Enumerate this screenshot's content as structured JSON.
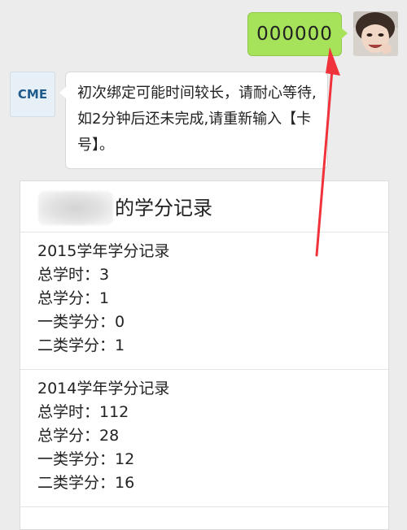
{
  "outgoing_message": {
    "text": "000000"
  },
  "incoming_message": {
    "avatar_text": "CME",
    "text": "初次绑定可能时间较长，请耐心等待,如2分钟后还未完成,请重新输入【卡号】。"
  },
  "credit_card": {
    "title": "的学分记录",
    "records": [
      {
        "heading": "2015学年学分记录",
        "lines": [
          "总学时：3",
          "总学分：1",
          "一类学分：0",
          "二类学分：1"
        ]
      },
      {
        "heading": "2014学年学分记录",
        "lines": [
          "总学时：112",
          "总学分：28",
          "一类学分：12",
          "二类学分：16"
        ]
      }
    ]
  },
  "colors": {
    "outgoing_bubble": "#a6e35a",
    "arrow": "#f0323a",
    "cme_logo": "#1f5b8d"
  },
  "icons": {
    "user_avatar": "user-photo-avatar",
    "cme_avatar": "cme-logo-avatar",
    "annotation": "red-arrow-annotation"
  }
}
